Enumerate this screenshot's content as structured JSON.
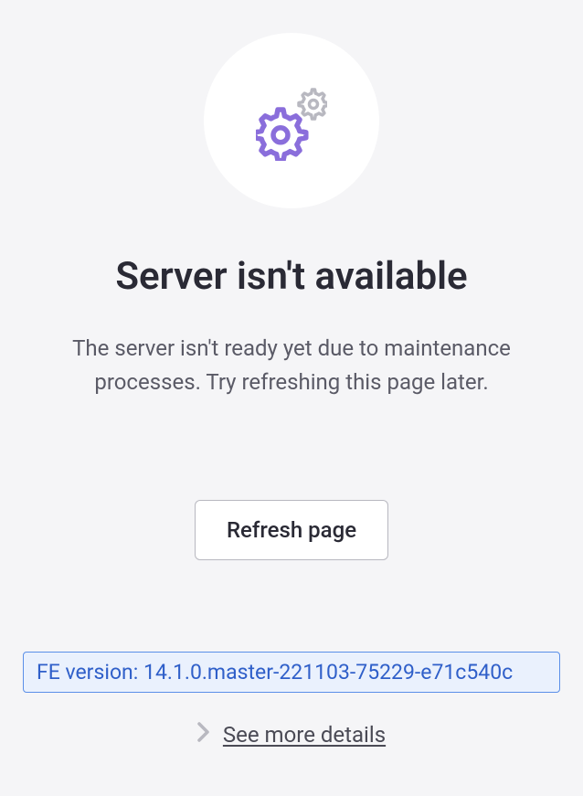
{
  "heading": "Server isn't available",
  "description": "The server isn't ready yet due to maintenance processes. Try refreshing this page later.",
  "refresh_button_label": "Refresh page",
  "version_text": "FE version: 14.1.0.master-221103-75229-e71c540c",
  "details_link_label": "See more details",
  "colors": {
    "accent_purple": "#8a6edb",
    "gray_gear": "#b8b8c0",
    "version_bg": "#eaf1fd",
    "version_border": "#5a8fe8",
    "version_text": "#2f5fc9"
  }
}
